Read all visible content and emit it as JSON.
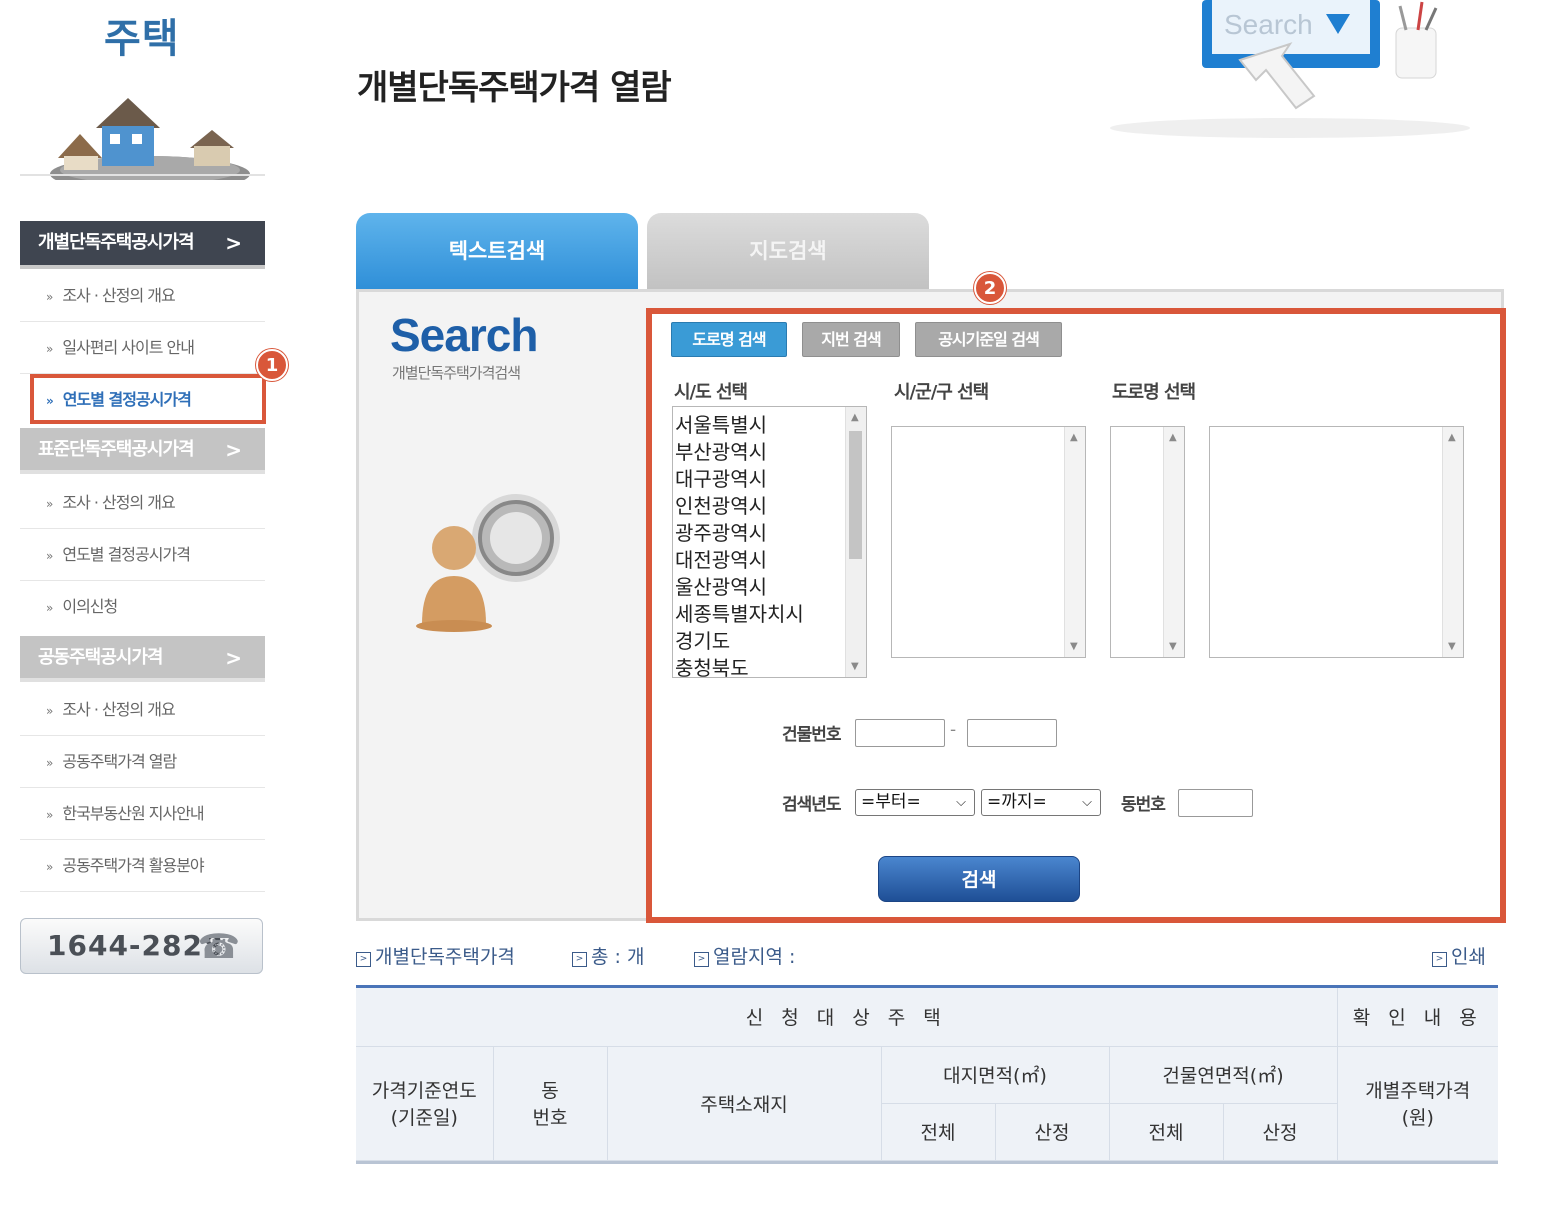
{
  "sidebar": {
    "title": "주택",
    "sections": [
      {
        "label": "개별단독주택공시가격",
        "items": [
          "조사 · 산정의 개요",
          "일사편리 사이트 안내",
          "연도별 결정공시가격"
        ]
      },
      {
        "label": "표준단독주택공시가격",
        "items": [
          "조사 · 산정의 개요",
          "연도별 결정공시가격",
          "이의신청"
        ]
      },
      {
        "label": "공동주택공시가격",
        "items": [
          "조사 · 산정의 개요",
          "공동주택가격 열람",
          "한국부동산원 지사안내",
          "공동주택가격 활용분야"
        ]
      }
    ],
    "phone": "1644-2828"
  },
  "header": {
    "title": "개별단독주택가격 열람",
    "illustration_text": "Search"
  },
  "badges": {
    "one": "1",
    "two": "2"
  },
  "tabs": {
    "text_search": "텍스트검색",
    "map_search": "지도검색"
  },
  "panel": {
    "search_word": "Search",
    "search_sub": "개별단독주택가격검색",
    "modes": {
      "road": "도로명 검색",
      "jibun": "지번 검색",
      "date": "공시기준일 검색"
    },
    "labels": {
      "sido": "시/도 선택",
      "sigungu": "시/군/구 선택",
      "road": "도로명 선택"
    },
    "sido_options": [
      "서울특별시",
      "부산광역시",
      "대구광역시",
      "인천광역시",
      "광주광역시",
      "대전광역시",
      "울산광역시",
      "세종특별자치시",
      "경기도",
      "충청북도"
    ],
    "building_label": "건물번호",
    "dash": "-",
    "year_label": "검색년도",
    "year_from": "=부터=",
    "year_to": "=까지=",
    "dong_label": "동번호",
    "search_button": "검색"
  },
  "info": {
    "item1": "개별단독주택가격",
    "item2": "총 : 개",
    "item3": "열람지역 :",
    "print": "인쇄"
  },
  "table": {
    "group_target": "신 청 대 상 주 택",
    "group_confirm": "확 인 내 용",
    "col_year_1": "가격기준연도",
    "col_year_2": "(기준일)",
    "col_dong_1": "동",
    "col_dong_2": "번호",
    "col_address": "주택소재지",
    "col_land": "대지면적(㎡)",
    "col_building": "건물연면적(㎡)",
    "col_price_1": "개별주택가격",
    "col_price_2": "(원)",
    "sub_total": "전체",
    "sub_calc": "산정"
  },
  "colors": {
    "accent": "#2f8fd8",
    "highlight": "#d9573a",
    "dark_menu": "#3f4550"
  },
  "icons": {
    "phone": "phone-icon",
    "arrow": "chevron-right-icon",
    "bullet": "double-chevron-icon"
  }
}
